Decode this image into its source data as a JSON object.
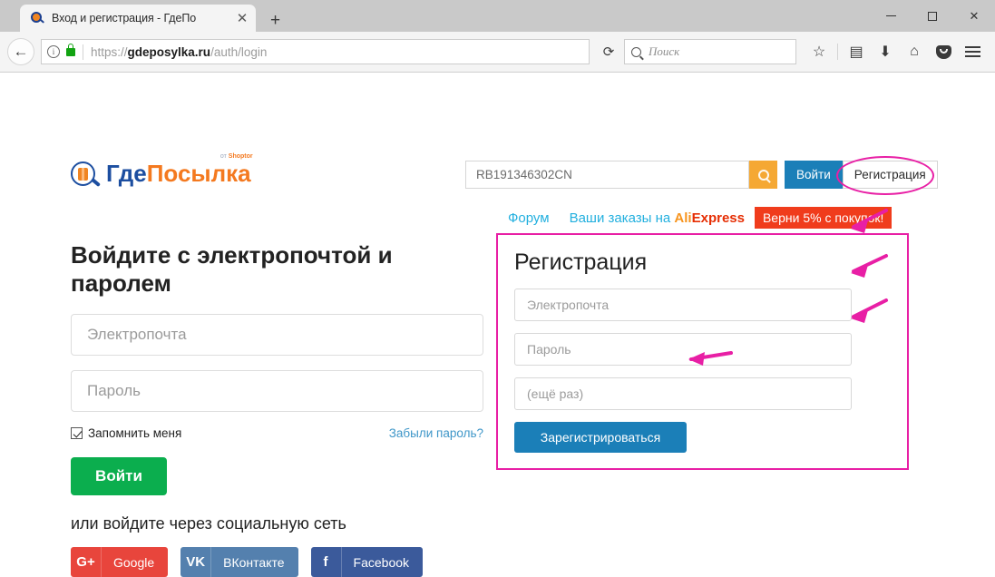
{
  "browser": {
    "tab": {
      "title": "Вход и регистрация - ГдеПо",
      "close_label": "✕",
      "favicon": "gdeposylka-favicon-icon"
    },
    "new_tab_label": "+",
    "window_controls": {
      "minimize": "minimize-icon",
      "maximize": "maximize-icon",
      "close": "✕"
    },
    "url": {
      "scheme": "https://",
      "host": "gdeposylka.ru",
      "path": "/auth/login"
    },
    "info_icon_label": "i",
    "reload_label": "⟳",
    "search": {
      "placeholder": "Поиск"
    },
    "toolbar_icons": [
      "star-icon",
      "library-icon",
      "download-icon",
      "home-icon",
      "pocket-icon",
      "menu-icon"
    ],
    "star_glyph": "☆",
    "library_glyph": "▤",
    "download_glyph": "⬇",
    "home_glyph": "⌂"
  },
  "site": {
    "logo": {
      "part1": "Где",
      "part2": "Посылка",
      "sup_prefix": "от ",
      "sup_brand": "Shoptor",
      "sup_mark": "®"
    },
    "tracking": {
      "value": "RB191346302CN",
      "search_button": "search-icon"
    },
    "login_button": "Войти",
    "register_button": "Регистрация",
    "promo": {
      "forum": "Форум",
      "orders_prefix": "Ваши заказы на ",
      "ali_part1": "Ali",
      "ali_part2": "Express",
      "badge": "Верни 5% с покупок!"
    }
  },
  "login": {
    "title": "Войдите с электропочтой и паролем",
    "email_placeholder": "Электропочта",
    "password_placeholder": "Пароль",
    "remember_label": "Запомнить меня",
    "forgot_label": "Забыли пароль?",
    "submit_label": "Войти",
    "social_label": "или войдите через социальную сеть",
    "social": [
      {
        "name": "Google",
        "icon": "G+"
      },
      {
        "name": "ВКонтакте",
        "icon": "VK"
      },
      {
        "name": "Facebook",
        "icon": "f"
      }
    ]
  },
  "register": {
    "title": "Регистрация",
    "email_placeholder": "Электропочта",
    "password_placeholder": "Пароль",
    "password_repeat_placeholder": "(ещё раз)",
    "submit_label": "Зарегистрироваться"
  },
  "annotations": {
    "color": "#e81fa5",
    "ellipse_target": "register-button-top",
    "arrow_count": 4
  },
  "colors": {
    "accent_orange": "#f4791f",
    "accent_blue": "#1b7fb8",
    "logo_blue": "#1c4ea0",
    "green": "#0bae4e",
    "link_cyan": "#23b0df",
    "badge_red": "#f03c1c",
    "annotation_magenta": "#e81fa5"
  }
}
